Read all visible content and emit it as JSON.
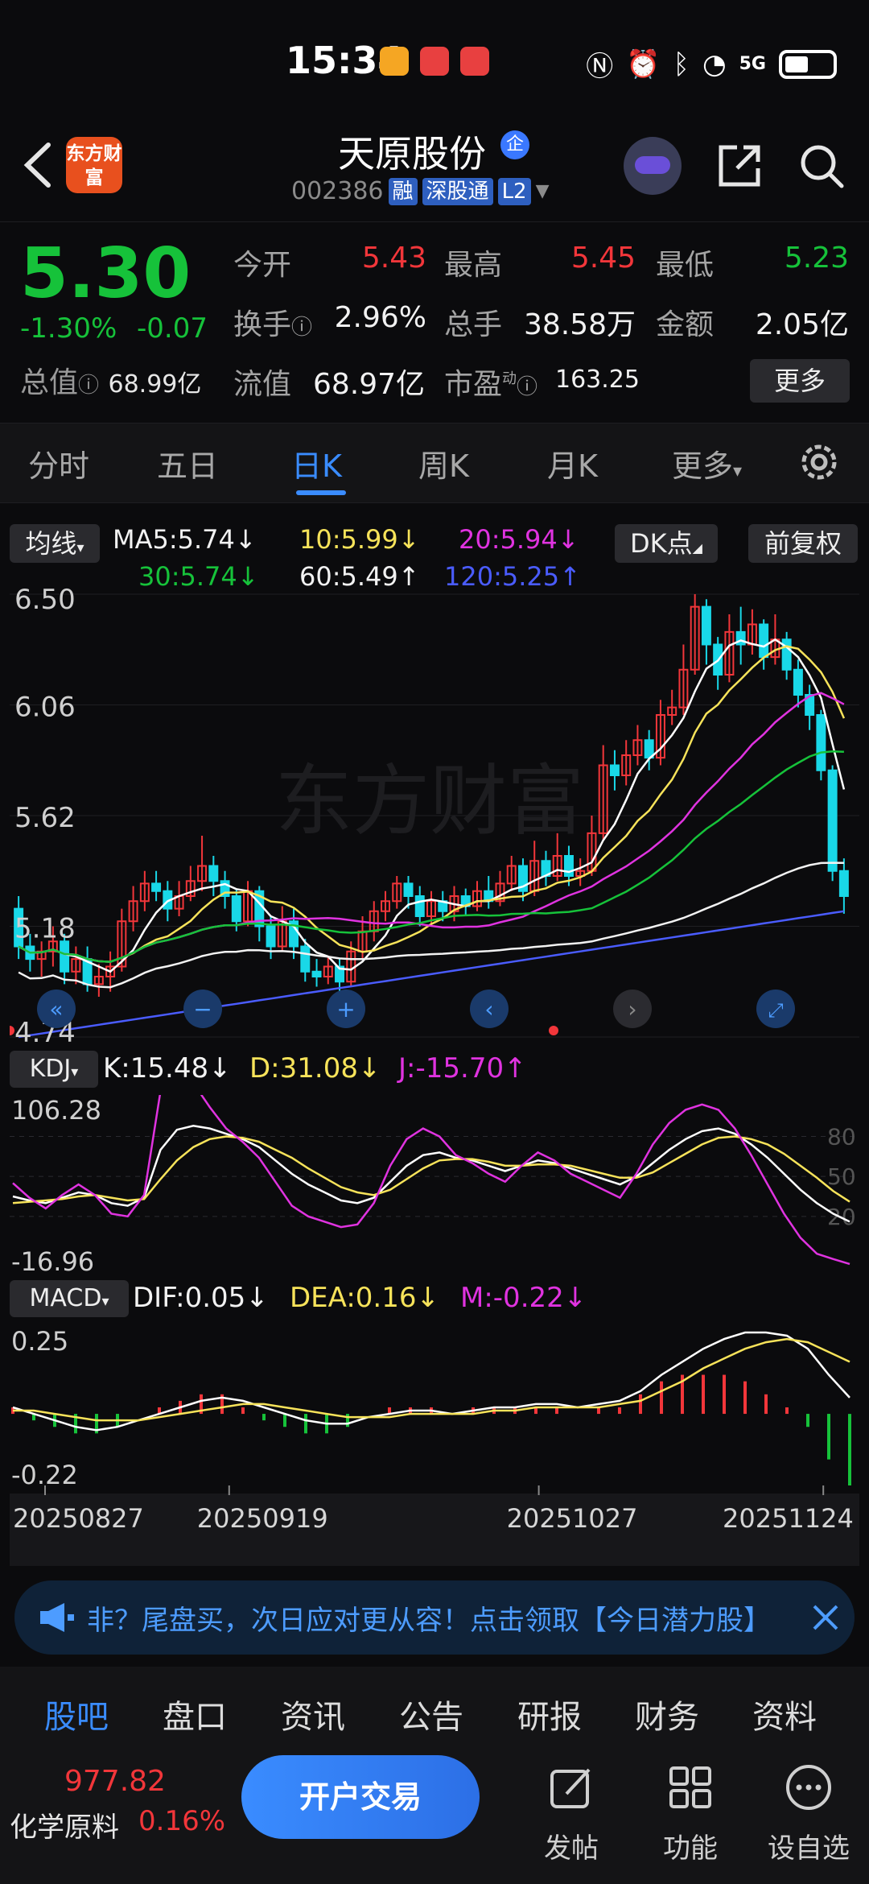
{
  "status": {
    "time": "15:34",
    "network": "5G"
  },
  "header": {
    "app_logo": "东方财富",
    "stock_name": "天原股份",
    "ent_badge": "企",
    "code": "002386",
    "tags": [
      "融",
      "深股通",
      "L2"
    ]
  },
  "quote": {
    "price": "5.30",
    "chg_pct": "-1.30%",
    "chg": "-0.07",
    "open_label": "今开",
    "open": "5.43",
    "high_label": "最高",
    "high": "5.45",
    "low_label": "最低",
    "low": "5.23",
    "turnover_label": "换手",
    "turnover": "2.96%",
    "volume_label": "总手",
    "volume": "38.58万",
    "amount_label": "金额",
    "amount": "2.05亿",
    "mktcap_label": "总值",
    "mktcap": "68.99亿",
    "float_label": "流值",
    "float": "68.97亿",
    "pe_label": "市盈",
    "pe_sup": "动",
    "pe": "163.25",
    "more": "更多"
  },
  "tabs": [
    "分时",
    "五日",
    "日K",
    "周K",
    "月K",
    "更多"
  ],
  "ma": {
    "selector": "均线",
    "ma5": "MA5:5.74↓",
    "ma10": "10:5.99↓",
    "ma20": "20:5.94↓",
    "ma30": "30:5.74↓",
    "ma60": "60:5.49↑",
    "ma120": "120:5.25↑",
    "dk": "DK点",
    "adjust": "前复权"
  },
  "chart_data": [
    {
      "type": "candlestick",
      "yticks": [
        "6.50",
        "6.06",
        "5.62",
        "5.18",
        "4.74"
      ],
      "ylim": [
        4.74,
        6.5
      ],
      "watermark": "东方财富",
      "candles": [
        [
          5.25,
          5.1,
          5.3,
          5.05
        ],
        [
          5.1,
          5.05,
          5.15,
          5.0
        ],
        [
          5.05,
          5.08,
          5.12,
          4.98
        ],
        [
          5.08,
          5.12,
          5.18,
          5.02
        ],
        [
          5.12,
          5.0,
          5.15,
          4.95
        ],
        [
          5.0,
          5.05,
          5.1,
          4.95
        ],
        [
          5.05,
          4.95,
          5.1,
          4.92
        ],
        [
          4.95,
          4.98,
          5.03,
          4.9
        ],
        [
          4.98,
          5.02,
          5.08,
          4.92
        ],
        [
          5.02,
          5.2,
          5.25,
          5.0
        ],
        [
          5.2,
          5.28,
          5.34,
          5.16
        ],
        [
          5.28,
          5.35,
          5.4,
          5.24
        ],
        [
          5.35,
          5.32,
          5.4,
          5.28
        ],
        [
          5.32,
          5.25,
          5.36,
          5.2
        ],
        [
          5.25,
          5.3,
          5.36,
          5.22
        ],
        [
          5.3,
          5.36,
          5.42,
          5.28
        ],
        [
          5.36,
          5.42,
          5.54,
          5.32
        ],
        [
          5.42,
          5.36,
          5.46,
          5.3
        ],
        [
          5.36,
          5.3,
          5.4,
          5.25
        ],
        [
          5.3,
          5.2,
          5.33,
          5.16
        ],
        [
          5.2,
          5.32,
          5.36,
          5.18
        ],
        [
          5.32,
          5.18,
          5.34,
          5.12
        ],
        [
          5.18,
          5.1,
          5.22,
          5.05
        ],
        [
          5.1,
          5.2,
          5.26,
          5.08
        ],
        [
          5.2,
          5.1,
          5.25,
          5.05
        ],
        [
          5.1,
          5.0,
          5.13,
          4.96
        ],
        [
          5.0,
          4.98,
          5.05,
          4.94
        ],
        [
          4.98,
          5.02,
          5.06,
          4.95
        ],
        [
          5.02,
          4.96,
          5.05,
          4.92
        ],
        [
          4.96,
          5.08,
          5.12,
          4.94
        ],
        [
          5.08,
          5.16,
          5.22,
          5.05
        ],
        [
          5.16,
          5.24,
          5.28,
          5.12
        ],
        [
          5.24,
          5.28,
          5.32,
          5.2
        ],
        [
          5.28,
          5.35,
          5.38,
          5.25
        ],
        [
          5.35,
          5.3,
          5.38,
          5.25
        ],
        [
          5.3,
          5.22,
          5.34,
          5.18
        ],
        [
          5.22,
          5.28,
          5.32,
          5.18
        ],
        [
          5.28,
          5.24,
          5.32,
          5.2
        ],
        [
          5.24,
          5.3,
          5.34,
          5.2
        ],
        [
          5.3,
          5.26,
          5.33,
          5.22
        ],
        [
          5.26,
          5.32,
          5.36,
          5.24
        ],
        [
          5.32,
          5.28,
          5.38,
          5.25
        ],
        [
          5.28,
          5.35,
          5.4,
          5.26
        ],
        [
          5.35,
          5.42,
          5.46,
          5.32
        ],
        [
          5.42,
          5.32,
          5.45,
          5.28
        ],
        [
          5.32,
          5.44,
          5.52,
          5.3
        ],
        [
          5.44,
          5.38,
          5.48,
          5.34
        ],
        [
          5.38,
          5.46,
          5.55,
          5.36
        ],
        [
          5.46,
          5.38,
          5.5,
          5.34
        ],
        [
          5.38,
          5.4,
          5.45,
          5.34
        ],
        [
          5.4,
          5.55,
          5.62,
          5.38
        ],
        [
          5.55,
          5.82,
          5.9,
          5.52
        ],
        [
          5.82,
          5.78,
          5.88,
          5.72
        ],
        [
          5.78,
          5.86,
          5.92,
          5.74
        ],
        [
          5.86,
          5.92,
          5.98,
          5.82
        ],
        [
          5.92,
          5.85,
          5.96,
          5.8
        ],
        [
          5.85,
          6.02,
          6.08,
          5.82
        ],
        [
          6.02,
          6.05,
          6.12,
          5.98
        ],
        [
          6.05,
          6.2,
          6.3,
          6.02
        ],
        [
          6.2,
          6.45,
          6.5,
          6.18
        ],
        [
          6.45,
          6.3,
          6.48,
          6.22
        ],
        [
          6.3,
          6.18,
          6.33,
          6.12
        ],
        [
          6.18,
          6.35,
          6.42,
          6.15
        ],
        [
          6.35,
          6.3,
          6.45,
          6.22
        ],
        [
          6.3,
          6.38,
          6.44,
          6.26
        ],
        [
          6.38,
          6.25,
          6.4,
          6.2
        ],
        [
          6.25,
          6.32,
          6.42,
          6.22
        ],
        [
          6.32,
          6.2,
          6.35,
          6.16
        ],
        [
          6.2,
          6.1,
          6.24,
          6.05
        ],
        [
          6.1,
          6.02,
          6.14,
          5.96
        ],
        [
          6.02,
          5.8,
          6.04,
          5.76
        ],
        [
          5.8,
          5.4,
          5.82,
          5.36
        ],
        [
          5.4,
          5.3,
          5.45,
          5.23
        ]
      ]
    },
    {
      "type": "line",
      "name": "KDJ",
      "yticks": [
        "106.28",
        "-16.96"
      ],
      "ylim": [
        -16.96,
        106.28
      ],
      "rticks": [
        "80",
        "50",
        "20"
      ],
      "series": [
        {
          "name": "K",
          "value_label": "K:15.48↓",
          "color": "#ffffff",
          "values": [
            35,
            32,
            30,
            34,
            38,
            36,
            30,
            28,
            34,
            70,
            85,
            88,
            86,
            82,
            78,
            72,
            62,
            52,
            44,
            38,
            32,
            30,
            34,
            46,
            58,
            66,
            68,
            64,
            62,
            58,
            54,
            58,
            62,
            60,
            56,
            52,
            48,
            44,
            50,
            60,
            70,
            78,
            84,
            86,
            82,
            74,
            64,
            52,
            40,
            30,
            22,
            16
          ]
        },
        {
          "name": "D",
          "value_label": "D:31.08↓",
          "color": "#f7e35a",
          "values": [
            30,
            31,
            32,
            33,
            35,
            36,
            34,
            32,
            33,
            48,
            62,
            72,
            78,
            80,
            79,
            76,
            70,
            64,
            56,
            49,
            42,
            38,
            36,
            40,
            48,
            56,
            62,
            63,
            63,
            61,
            58,
            58,
            59,
            59,
            58,
            55,
            52,
            49,
            49,
            53,
            60,
            67,
            74,
            79,
            80,
            78,
            74,
            67,
            58,
            49,
            39,
            31
          ]
        },
        {
          "name": "J",
          "value_label": "J:-15.70↑",
          "color": "#e033e0",
          "values": [
            45,
            34,
            26,
            36,
            44,
            36,
            22,
            20,
            36,
            114,
            131,
            120,
            102,
            86,
            76,
            64,
            46,
            28,
            20,
            16,
            12,
            14,
            30,
            58,
            78,
            86,
            80,
            66,
            60,
            52,
            46,
            58,
            68,
            62,
            52,
            46,
            40,
            34,
            52,
            74,
            90,
            100,
            104,
            100,
            86,
            66,
            44,
            22,
            4,
            -8,
            -12,
            -15.7
          ]
        }
      ]
    },
    {
      "type": "bar+line",
      "name": "MACD",
      "yticks": [
        "0.25",
        "-0.22"
      ],
      "ylim": [
        -0.22,
        0.25
      ],
      "series": [
        {
          "name": "DIF",
          "value_label": "DIF:0.05↓",
          "color": "#ffffff",
          "values": [
            0.02,
            0.0,
            -0.02,
            -0.04,
            -0.05,
            -0.04,
            -0.02,
            0.0,
            0.02,
            0.04,
            0.05,
            0.04,
            0.02,
            0.0,
            -0.02,
            -0.03,
            -0.03,
            -0.01,
            0.0,
            0.01,
            0.01,
            0.0,
            0.01,
            0.02,
            0.02,
            0.03,
            0.03,
            0.02,
            0.03,
            0.04,
            0.07,
            0.12,
            0.16,
            0.2,
            0.23,
            0.25,
            0.25,
            0.24,
            0.2,
            0.12,
            0.05
          ]
        },
        {
          "name": "DEA",
          "value_label": "DEA:0.16↓",
          "color": "#f7e35a",
          "values": [
            0.01,
            0.01,
            0.0,
            -0.01,
            -0.02,
            -0.02,
            -0.02,
            -0.01,
            0.0,
            0.01,
            0.02,
            0.03,
            0.03,
            0.02,
            0.01,
            0.0,
            -0.01,
            -0.01,
            -0.01,
            0.0,
            0.0,
            0.0,
            0.0,
            0.01,
            0.01,
            0.02,
            0.02,
            0.02,
            0.02,
            0.03,
            0.04,
            0.07,
            0.1,
            0.14,
            0.17,
            0.2,
            0.22,
            0.23,
            0.22,
            0.19,
            0.16
          ]
        },
        {
          "name": "M",
          "value_label": "M:-0.22↓",
          "color": "#e033e0"
        }
      ],
      "xticks": [
        "20250827",
        "20250919",
        "20251027",
        "20251124"
      ]
    }
  ],
  "banner": {
    "text": "非？尾盘买，次日应对更从容！点击领取【今日潜力股】"
  },
  "bottom_tabs": [
    "股吧",
    "盘口",
    "资讯",
    "公告",
    "研报",
    "财务",
    "资料"
  ],
  "footer": {
    "index_val": "977.82",
    "index_name": "化学原料",
    "index_pct": "0.16%",
    "trade": "开户交易",
    "post": "发帖",
    "func": "功能",
    "watchlist": "设自选"
  },
  "indicators": {
    "kdj": "KDJ",
    "macd": "MACD"
  }
}
